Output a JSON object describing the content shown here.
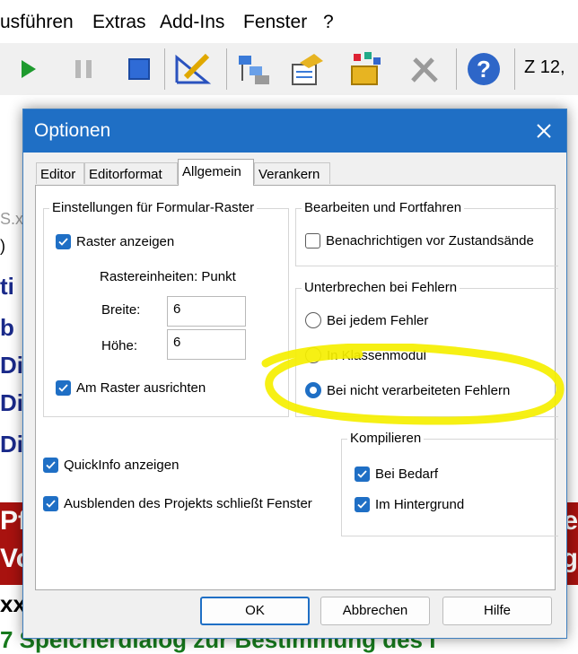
{
  "menu": [
    "usführen",
    "Extras",
    "Add-Ins",
    "Fenster",
    "?"
  ],
  "toolbar": {
    "icons": [
      "run-icon",
      "pause-icon",
      "stop-icon",
      "design-mode-icon",
      "project-explorer-icon",
      "properties-window-icon",
      "object-browser-icon",
      "toolbox-icon",
      "help-icon"
    ],
    "position_readout": "Z 12,"
  },
  "background": {
    "strip_texts": [
      "S.x",
      ")",
      "ti",
      "b",
      "Di",
      "Di",
      "Di"
    ],
    "band_left": [
      "Pf",
      "Vo"
    ],
    "band_right": [
      "e",
      "g"
    ],
    "xx": "xx",
    "bottom_line": "7 Speicherdialog zur Bestimmung des I"
  },
  "dialog": {
    "title": "Optionen",
    "tabs": [
      "Editor",
      "Editorformat",
      "Allgemein",
      "Verankern"
    ],
    "active_tab": "Allgemein",
    "raster_group": {
      "label": "Einstellungen für Formular-Raster",
      "show_grid": "Raster anzeigen",
      "units": "Rastereinheiten: Punkt",
      "width_label": "Breite:",
      "width_value": "6",
      "height_label": "Höhe:",
      "height_value": "6",
      "align_grid": "Am Raster ausrichten"
    },
    "edit_group": {
      "label": "Bearbeiten und Fortfahren",
      "notify": "Benachrichtigen vor Zustandsände"
    },
    "error_group": {
      "label": "Unterbrechen bei Fehlern",
      "options": [
        "Bei jedem Fehler",
        "In Klassenmodul",
        "Bei nicht verarbeiteten Fehlern"
      ],
      "selected": "Bei nicht verarbeiteten Fehlern"
    },
    "quickinfo": "QuickInfo anzeigen",
    "hide_project": "Ausblenden des Projekts schließt Fenster",
    "compile_group": {
      "label": "Kompilieren",
      "on_demand": "Bei Bedarf",
      "background": "Im Hintergrund"
    },
    "buttons": {
      "ok": "OK",
      "cancel": "Abbrechen",
      "help": "Hilfe"
    }
  },
  "colors": {
    "accent": "#1f6fc5",
    "highlight": "#f5ef00",
    "band": "#a8120f",
    "background_text": "#1a2a8a",
    "bottom_text": "#177a1d"
  }
}
